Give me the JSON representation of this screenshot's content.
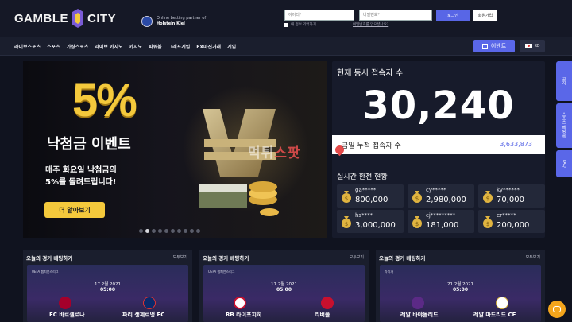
{
  "header": {
    "logo_left": "GAMBLE",
    "logo_right": "CITY",
    "partner_line": "Online betting partner of",
    "partner_name": "Holstein Kiel",
    "id_placeholder": "아이디*",
    "pw_placeholder": "비밀번호*",
    "login_label": "로그인",
    "join_label": "회원가입",
    "remember_label": "내 정보 기억하기",
    "find_label": "비밀번호를 잊으셨나요?"
  },
  "nav": {
    "items": [
      "라이브스포츠",
      "스포츠",
      "가상스포츠",
      "라이브 카지노",
      "카지노",
      "파워볼",
      "그래프게임",
      "FX마진거래",
      "게임"
    ],
    "event_label": "이벤트",
    "lang_label": "KO"
  },
  "banner": {
    "percent": "5%",
    "title": "낙첨금 이벤트",
    "subtitle_line1": "매주 화요일 낙첨금의",
    "subtitle_line2": "5%를 돌려드립니다!",
    "more_label": "더 알아보기",
    "dots_total": 10,
    "dots_active": 1
  },
  "live": {
    "title": "현재 동시 접속자 수",
    "count": "30,240",
    "cumulative_label": "금일 누적 접속자 수",
    "cumulative_value": "3,633,873",
    "exchange_title": "실시간 환전 현황",
    "exchanges": [
      {
        "name": "ga*****",
        "amount": "800,000"
      },
      {
        "name": "cy*****",
        "amount": "2,980,000"
      },
      {
        "name": "ky******",
        "amount": "70,000"
      },
      {
        "name": "hs****",
        "amount": "3,000,000"
      },
      {
        "name": "cj*********",
        "amount": "181,000"
      },
      {
        "name": "er*****",
        "amount": "200,000"
      }
    ]
  },
  "watermark": {
    "part1": "먹튀",
    "part2": "스팟"
  },
  "side_tabs": [
    "공지",
    "스포츠 베팅 룰",
    "FAQ"
  ],
  "bets": [
    {
      "title": "오늘의 경기 베팅하기",
      "more": "모두보기",
      "league": "UEFA 챔피언스리그",
      "date": "17 2월 2021",
      "time": "05:00",
      "home": "FC 바르셀로나",
      "away": "파리 생제르맹 FC"
    },
    {
      "title": "오늘의 경기 베팅하기",
      "more": "모두보기",
      "league": "UEFA 챔피언스리그",
      "date": "17 2월 2021",
      "time": "05:00",
      "home": "RB 라이프치히",
      "away": "리버풀"
    },
    {
      "title": "오늘의 경기 베팅하기",
      "more": "모두보기",
      "league": "라리가",
      "date": "21 2월 2021",
      "time": "05:00",
      "home": "레알 바야돌리드",
      "away": "레알 마드리드 CF"
    }
  ],
  "colors": {
    "accent": "#5a67e8",
    "gold": "#f4c93c",
    "chat": "#f3a51c"
  }
}
